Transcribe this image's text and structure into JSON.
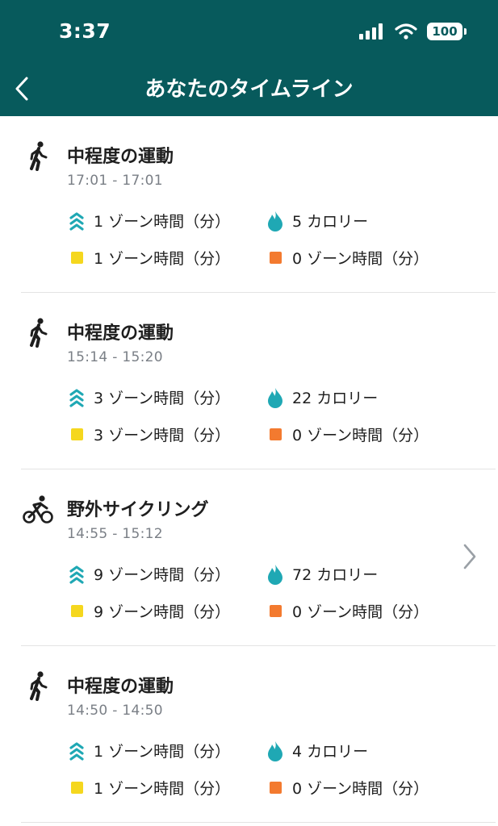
{
  "status_bar": {
    "time": "3:37",
    "battery": "100"
  },
  "header": {
    "title": "あなたのタイムライン",
    "back_icon": "chevron-left-icon"
  },
  "colors": {
    "header_bg": "#075a5c",
    "teal": "#1fa8b4",
    "yellow": "#f5d71e",
    "orange": "#f37a2f"
  },
  "entries": [
    {
      "activity": "中程度の運動",
      "icon": "walking-icon",
      "time_range": "17:01 - 17:01",
      "zone_minutes": "1 ゾーン時間（分）",
      "calories": "5 カロリー",
      "fat_burn": "1 ゾーン時間（分）",
      "peak": "0 ゾーン時間（分）"
    },
    {
      "activity": "中程度の運動",
      "icon": "walking-icon",
      "time_range": "15:14 - 15:20",
      "zone_minutes": "3 ゾーン時間（分）",
      "calories": "22 カロリー",
      "fat_burn": "3 ゾーン時間（分）",
      "peak": "0 ゾーン時間（分）"
    },
    {
      "activity": "野外サイクリング",
      "icon": "cycling-icon",
      "time_range": "14:55 - 15:12",
      "zone_minutes": "9 ゾーン時間（分）",
      "calories": "72 カロリー",
      "fat_burn": "9 ゾーン時間（分）",
      "peak": "0 ゾーン時間（分）",
      "has_detail": true
    },
    {
      "activity": "中程度の運動",
      "icon": "walking-icon",
      "time_range": "14:50 - 14:50",
      "zone_minutes": "1 ゾーン時間（分）",
      "calories": "4 カロリー",
      "fat_burn": "1 ゾーン時間（分）",
      "peak": "0 ゾーン時間（分）"
    }
  ]
}
